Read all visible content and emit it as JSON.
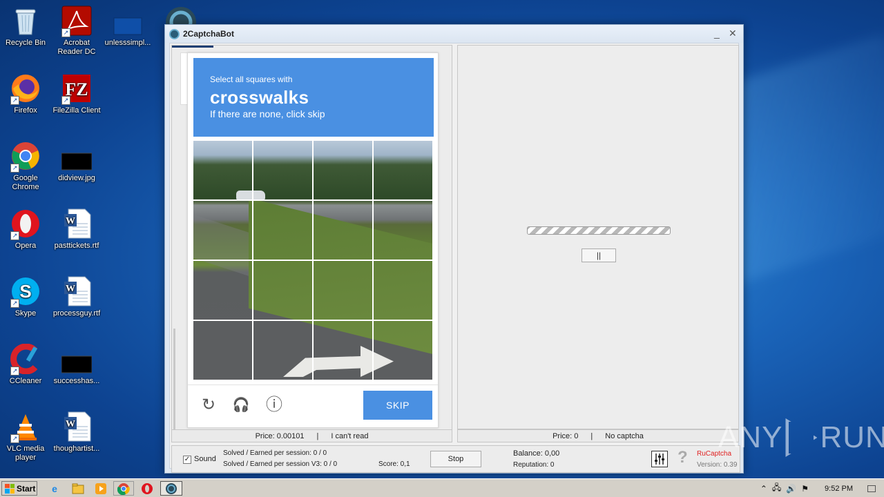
{
  "desktop": {
    "icons": [
      {
        "label": "Recycle Bin"
      },
      {
        "label": "Acrobat Reader DC"
      },
      {
        "label": "unlesssimpl..."
      },
      {
        "label": "Firefox"
      },
      {
        "label": "FileZilla Client"
      },
      {
        "label": "Google Chrome"
      },
      {
        "label": "didview.jpg"
      },
      {
        "label": "Opera"
      },
      {
        "label": "pasttickets.rtf"
      },
      {
        "label": "Skype"
      },
      {
        "label": "processguy.rtf"
      },
      {
        "label": "CCleaner"
      },
      {
        "label": "successhas..."
      },
      {
        "label": "VLC media player"
      },
      {
        "label": "thoughartist..."
      }
    ]
  },
  "window": {
    "title": "2CaptchaBot",
    "minimize": "_",
    "close": "✕"
  },
  "captcha": {
    "instruction_line1": "Select all squares with",
    "target": "crosswalks",
    "instruction_line3": "If there are none, click skip",
    "reload_icon": "↻",
    "audio_icon": "🎧",
    "info_icon": "ⓘ",
    "skip_label": "SKIP"
  },
  "left_status": {
    "price": "Price: 0.00101",
    "sep": "|",
    "action": "I can't read"
  },
  "right_panel": {
    "pause_label": "||"
  },
  "right_status": {
    "price": "Price: 0",
    "sep": "|",
    "action": "No captcha"
  },
  "bottom": {
    "sound_check": "✓",
    "sound_label": "Sound",
    "solved_line1": "Solved / Earned per session: 0 / 0",
    "solved_line2": "Solved / Earned per session V3: 0 / 0",
    "score": "Score: 0,1",
    "stop_label": "Stop",
    "balance": "Balance:  0,00",
    "reputation": "Reputation: 0",
    "help_icon": "?",
    "ru_captcha": "RuCaptcha",
    "version": "Version: 0.39"
  },
  "taskbar": {
    "start_label": "Start",
    "clock": "9:52 PM"
  },
  "watermark": {
    "text_left": "ANY",
    "text_right": "RUN"
  },
  "colors": {
    "captcha_blue": "#4a90e2",
    "ru_captcha_red": "#e02020"
  }
}
